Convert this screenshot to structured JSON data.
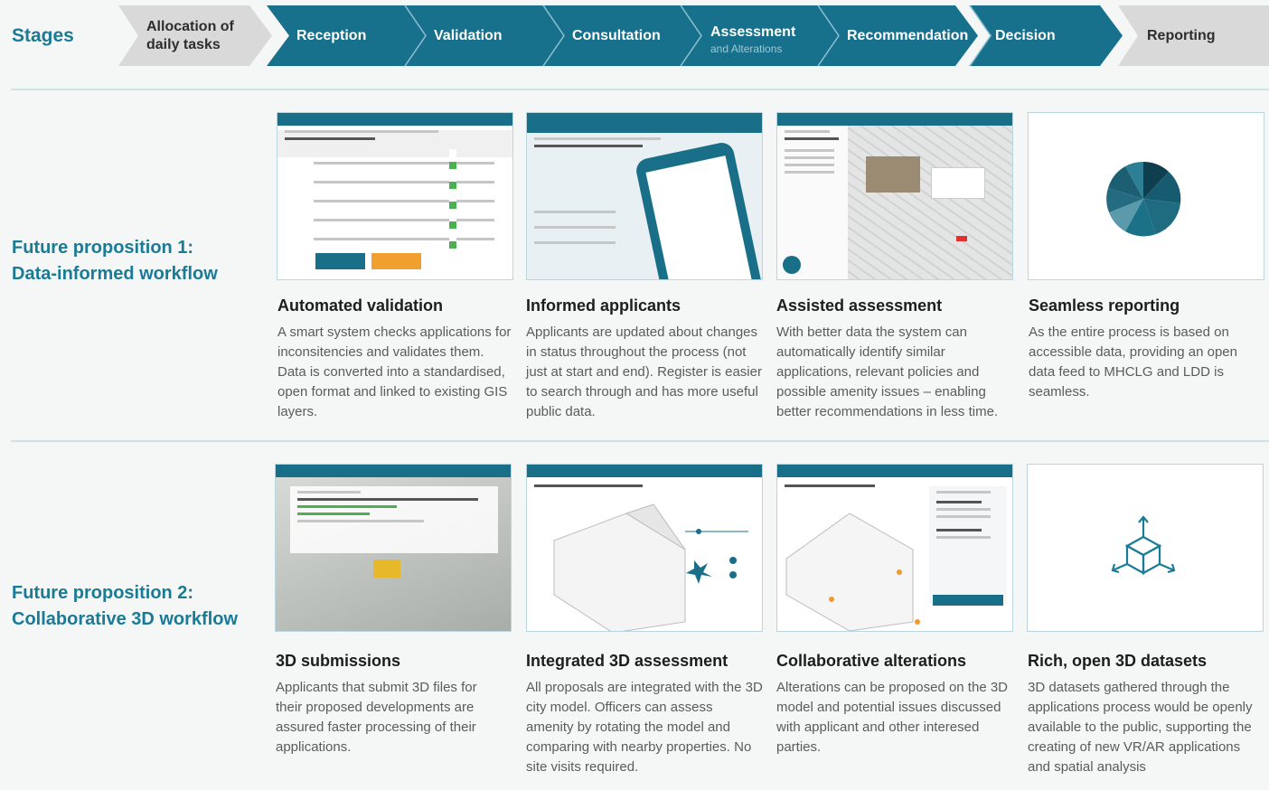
{
  "stages_label": "Stages",
  "stages": [
    {
      "label": "Allocation of daily tasks",
      "line1": "Allocation of",
      "line2": "daily tasks",
      "sub": "",
      "style": "grey"
    },
    {
      "label": "Reception",
      "sub": "",
      "style": "teal"
    },
    {
      "label": "Validation",
      "sub": "",
      "style": "teal"
    },
    {
      "label": "Consultation",
      "sub": "",
      "style": "teal"
    },
    {
      "label": "Assessment",
      "sub": "and Alterations",
      "style": "teal"
    },
    {
      "label": "Recommendation",
      "sub": "",
      "style": "teal"
    },
    {
      "label": "Decision",
      "sub": "",
      "style": "teal"
    },
    {
      "label": "Reporting",
      "sub": "",
      "style": "grey"
    }
  ],
  "propositions": [
    {
      "title_line1": "Future proposition 1:",
      "title_line2": "Data-informed workflow",
      "cards": [
        {
          "title": "Automated validation",
          "desc": "A smart system checks applications for inconsitencies and validates them. Data is converted into a standardised, open format and linked to existing GIS layers."
        },
        {
          "title": "Informed applicants",
          "desc": "Applicants are updated about changes in status throughout the process (not just at start and end). Register is easier to search through and has more useful public data."
        },
        {
          "title": "Assisted assessment",
          "desc": "With better data the system can automatically identify similar applications, relevant policies and possible amenity issues – enabling better recommendations in less time."
        },
        {
          "title": "Seamless reporting",
          "desc": "As the entire process is based on accessible data, providing an open data feed to MHCLG and LDD is seamless."
        }
      ]
    },
    {
      "title_line1": "Future proposition 2:",
      "title_line2": "Collaborative 3D workflow",
      "cards": [
        {
          "title": "3D submissions",
          "desc": "Applicants that submit 3D files for their proposed developments are assured faster processing of their applications."
        },
        {
          "title": "Integrated 3D assessment",
          "desc": "All proposals are integrated with the 3D city model. Officers can assess amenity by rotating the model and comparing with nearby properties. No site visits required."
        },
        {
          "title": "Collaborative alterations",
          "desc": "Alterations can be proposed on the 3D model and potential issues discussed with applicant and other interesed parties."
        },
        {
          "title": "Rich, open 3D datasets",
          "desc": "3D datasets gathered through the applications process would be openly available to the public, supporting the creating of new VR/AR applications and spatial analysis"
        }
      ]
    }
  ],
  "colors": {
    "teal": "#17718c",
    "grey": "#d9d9d9",
    "title": "#1a7b96"
  },
  "icons": [
    "pie-chart-icon",
    "3d-cube-icon"
  ]
}
